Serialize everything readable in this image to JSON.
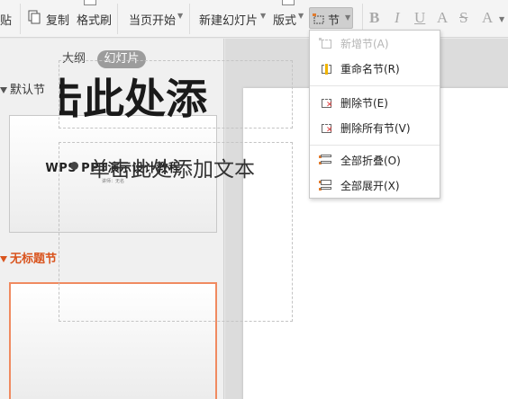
{
  "toolbar": {
    "paste": "贴",
    "copy": "复制",
    "format_painter": "格式刷",
    "start_from_current": "当页开始",
    "new_slide": "新建幻灯片",
    "layout": "版式",
    "section": "节"
  },
  "font_tools": [
    "B",
    "I",
    "U",
    "A",
    "S",
    "A"
  ],
  "panel_tabs": {
    "outline": "大纲",
    "slides": "幻灯片"
  },
  "sections": [
    {
      "name": "默认节"
    },
    {
      "name": "无标题节"
    }
  ],
  "thumbnails": [
    {
      "title": "WPS PPT演示设计教程",
      "subtitle": "讲师：无名"
    }
  ],
  "slide": {
    "title_visible": "击此处添",
    "body_text": "单击此处添加文本"
  },
  "section_menu": {
    "items": [
      {
        "label": "新增节(A)",
        "disabled": true
      },
      {
        "label": "重命名节(R)",
        "disabled": false
      },
      {
        "label": "删除节(E)",
        "disabled": false
      },
      {
        "label": "删除所有节(V)",
        "disabled": false
      },
      {
        "label": "全部折叠(O)",
        "disabled": false
      },
      {
        "label": "全部展开(X)",
        "disabled": false
      }
    ]
  },
  "colors": {
    "section_accent": "#d9541e",
    "selected_thumb_border": "#f08a60",
    "delete_icon": "#e03b3b"
  }
}
